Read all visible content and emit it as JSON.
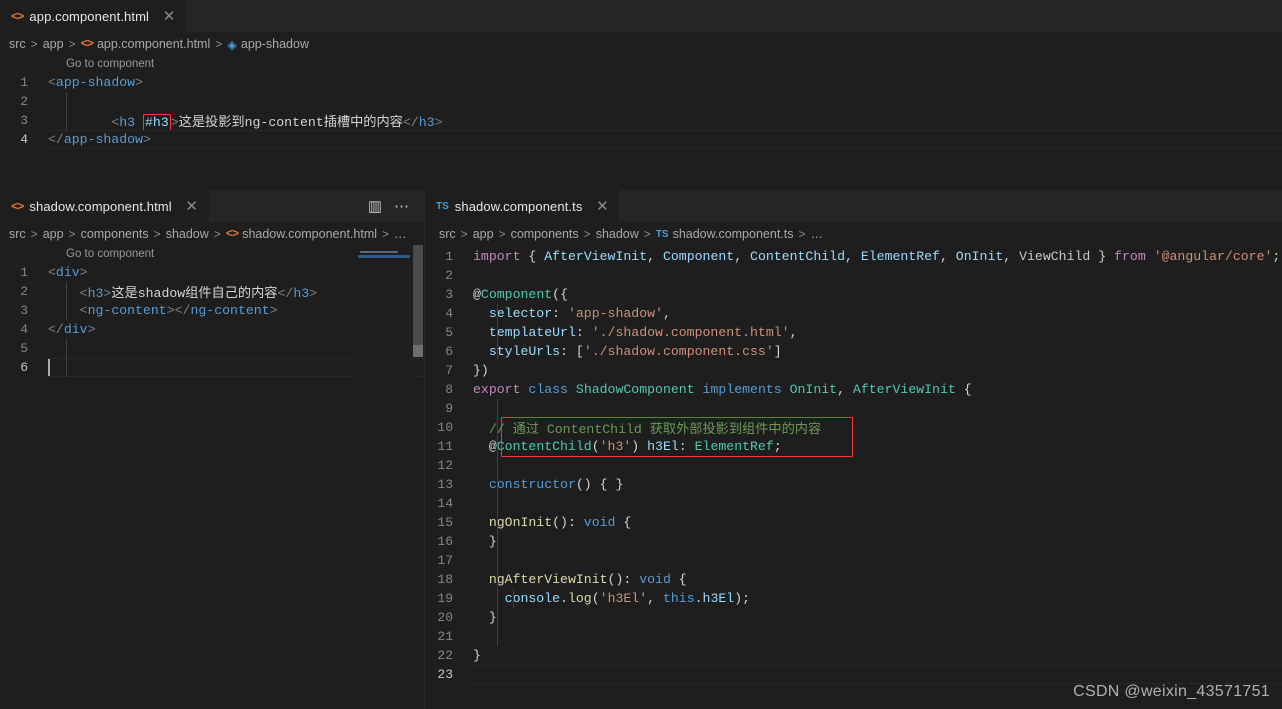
{
  "top_panel": {
    "tab": {
      "label": "app.component.html",
      "icon": "html-icon",
      "close": "✕",
      "dirty": false
    },
    "breadcrumb": [
      {
        "text": "src",
        "icon": null
      },
      {
        "text": "app",
        "icon": null
      },
      {
        "text": "app.component.html",
        "icon": "html-icon"
      },
      {
        "text": "app-shadow",
        "icon": "symbol-class-icon"
      }
    ],
    "codelens": "Go to component",
    "lines": [
      {
        "num": "1",
        "tokens": [
          {
            "t": "<",
            "c": "t-bracket"
          },
          {
            "t": "app-shadow",
            "c": "t-tag"
          },
          {
            "t": ">",
            "c": "t-bracket"
          }
        ]
      },
      {
        "num": "2",
        "tokens": []
      },
      {
        "num": "3",
        "tokens": [
          {
            "t": "        ",
            "c": "t-plain"
          },
          {
            "t": "<",
            "c": "t-bracket"
          },
          {
            "t": "h3",
            "c": "t-tag"
          },
          {
            "t": " ",
            "c": "t-plain"
          },
          {
            "t": "#h3",
            "c": "t-attr",
            "box": true
          },
          {
            "t": ">",
            "c": "t-bracket"
          },
          {
            "t": "这是投影到ng-content插槽中的内容",
            "c": "t-text"
          },
          {
            "t": "</",
            "c": "t-bracket"
          },
          {
            "t": "h3",
            "c": "t-tag"
          },
          {
            "t": ">",
            "c": "t-bracket"
          }
        ]
      },
      {
        "num": "4",
        "active": true,
        "tokens": [
          {
            "t": "</",
            "c": "t-bracket"
          },
          {
            "t": "app-shadow",
            "c": "t-tag"
          },
          {
            "t": ">",
            "c": "t-bracket"
          }
        ]
      }
    ]
  },
  "left_panel": {
    "tab": {
      "label": "shadow.component.html",
      "icon": "html-icon",
      "close": "✕"
    },
    "actions": [
      {
        "name": "split-editor-icon",
        "glyph": "▥"
      },
      {
        "name": "more-actions-icon",
        "glyph": "⋯"
      }
    ],
    "breadcrumb": [
      {
        "text": "src"
      },
      {
        "text": "app"
      },
      {
        "text": "components"
      },
      {
        "text": "shadow"
      },
      {
        "text": "shadow.component.html",
        "icon": "html-icon"
      },
      {
        "text": "…"
      }
    ],
    "codelens": "Go to component",
    "lines": [
      {
        "num": "1",
        "tokens": [
          {
            "t": "<",
            "c": "t-bracket"
          },
          {
            "t": "div",
            "c": "t-tag"
          },
          {
            "t": ">",
            "c": "t-bracket"
          }
        ]
      },
      {
        "num": "2",
        "tokens": [
          {
            "t": "    ",
            "c": "t-plain"
          },
          {
            "t": "<",
            "c": "t-bracket"
          },
          {
            "t": "h3",
            "c": "t-tag"
          },
          {
            "t": ">",
            "c": "t-bracket"
          },
          {
            "t": "这是shadow组件自己的内容",
            "c": "t-text"
          },
          {
            "t": "</",
            "c": "t-bracket"
          },
          {
            "t": "h3",
            "c": "t-tag"
          },
          {
            "t": ">",
            "c": "t-bracket"
          }
        ]
      },
      {
        "num": "3",
        "tokens": [
          {
            "t": "    ",
            "c": "t-plain"
          },
          {
            "t": "<",
            "c": "t-bracket"
          },
          {
            "t": "ng-content",
            "c": "t-tag"
          },
          {
            "t": ">",
            "c": "t-bracket"
          },
          {
            "t": "</",
            "c": "t-bracket"
          },
          {
            "t": "ng-content",
            "c": "t-tag"
          },
          {
            "t": ">",
            "c": "t-bracket"
          }
        ]
      },
      {
        "num": "4",
        "tokens": [
          {
            "t": "</",
            "c": "t-bracket"
          },
          {
            "t": "div",
            "c": "t-tag"
          },
          {
            "t": ">",
            "c": "t-bracket"
          }
        ]
      },
      {
        "num": "5",
        "tokens": []
      },
      {
        "num": "6",
        "active": true,
        "cursor": true,
        "tokens": []
      }
    ]
  },
  "right_panel": {
    "tab": {
      "label": "shadow.component.ts",
      "icon": "ts-icon",
      "close": "✕"
    },
    "breadcrumb": [
      {
        "text": "src"
      },
      {
        "text": "app"
      },
      {
        "text": "components"
      },
      {
        "text": "shadow"
      },
      {
        "text": "shadow.component.ts",
        "icon": "ts-icon"
      },
      {
        "text": "…"
      }
    ],
    "lines": [
      {
        "num": "1",
        "tokens": [
          {
            "t": "import",
            "c": "t-kw"
          },
          {
            "t": " ",
            "c": "t-plain"
          },
          {
            "t": "{",
            "c": "t-punc"
          },
          {
            "t": " ",
            "c": "t-plain"
          },
          {
            "t": "AfterViewInit",
            "c": "t-ident"
          },
          {
            "t": ", ",
            "c": "t-punc"
          },
          {
            "t": "Component",
            "c": "t-ident"
          },
          {
            "t": ", ",
            "c": "t-punc"
          },
          {
            "t": "ContentChild",
            "c": "t-ident"
          },
          {
            "t": ", ",
            "c": "t-punc"
          },
          {
            "t": "ElementRef",
            "c": "t-ident"
          },
          {
            "t": ", ",
            "c": "t-punc"
          },
          {
            "t": "OnInit",
            "c": "t-ident"
          },
          {
            "t": ", ",
            "c": "t-punc"
          },
          {
            "t": "ViewChild",
            "c": "t-dim"
          },
          {
            "t": " ",
            "c": "t-plain"
          },
          {
            "t": "}",
            "c": "t-punc"
          },
          {
            "t": " ",
            "c": "t-plain"
          },
          {
            "t": "from",
            "c": "t-kw"
          },
          {
            "t": " ",
            "c": "t-plain"
          },
          {
            "t": "'@angular/core'",
            "c": "t-string"
          },
          {
            "t": ";",
            "c": "t-punc"
          }
        ]
      },
      {
        "num": "2",
        "tokens": []
      },
      {
        "num": "3",
        "tokens": [
          {
            "t": "@",
            "c": "t-punc"
          },
          {
            "t": "Component",
            "c": "t-type"
          },
          {
            "t": "(",
            "c": "t-punc"
          },
          {
            "t": "{",
            "c": "t-punc"
          }
        ]
      },
      {
        "num": "4",
        "tokens": [
          {
            "t": "  ",
            "c": "t-plain"
          },
          {
            "t": "selector",
            "c": "t-ident"
          },
          {
            "t": ": ",
            "c": "t-punc"
          },
          {
            "t": "'app-shadow'",
            "c": "t-string"
          },
          {
            "t": ",",
            "c": "t-punc"
          }
        ]
      },
      {
        "num": "5",
        "tokens": [
          {
            "t": "  ",
            "c": "t-plain"
          },
          {
            "t": "templateUrl",
            "c": "t-ident"
          },
          {
            "t": ": ",
            "c": "t-punc"
          },
          {
            "t": "'./shadow.component.html'",
            "c": "t-string"
          },
          {
            "t": ",",
            "c": "t-punc"
          }
        ]
      },
      {
        "num": "6",
        "tokens": [
          {
            "t": "  ",
            "c": "t-plain"
          },
          {
            "t": "styleUrls",
            "c": "t-ident"
          },
          {
            "t": ": ",
            "c": "t-punc"
          },
          {
            "t": "[",
            "c": "t-punc"
          },
          {
            "t": "'./shadow.component.css'",
            "c": "t-string"
          },
          {
            "t": "]",
            "c": "t-punc"
          }
        ]
      },
      {
        "num": "7",
        "tokens": [
          {
            "t": "}",
            "c": "t-punc"
          },
          {
            "t": ")",
            "c": "t-punc"
          }
        ]
      },
      {
        "num": "8",
        "tokens": [
          {
            "t": "export",
            "c": "t-kw"
          },
          {
            "t": " ",
            "c": "t-plain"
          },
          {
            "t": "class",
            "c": "t-kw2"
          },
          {
            "t": " ",
            "c": "t-plain"
          },
          {
            "t": "ShadowComponent",
            "c": "t-type"
          },
          {
            "t": " ",
            "c": "t-plain"
          },
          {
            "t": "implements",
            "c": "t-kw2"
          },
          {
            "t": " ",
            "c": "t-plain"
          },
          {
            "t": "OnInit",
            "c": "t-type"
          },
          {
            "t": ", ",
            "c": "t-punc"
          },
          {
            "t": "AfterViewInit",
            "c": "t-type"
          },
          {
            "t": " ",
            "c": "t-plain"
          },
          {
            "t": "{",
            "c": "t-punc"
          }
        ]
      },
      {
        "num": "9",
        "tokens": []
      },
      {
        "num": "10",
        "tokens": [
          {
            "t": "  ",
            "c": "t-plain"
          },
          {
            "t": "// 通过 ContentChild 获取外部投影到组件中的内容",
            "c": "t-comment"
          }
        ]
      },
      {
        "num": "11",
        "tokens": [
          {
            "t": "  ",
            "c": "t-plain"
          },
          {
            "t": "@",
            "c": "t-punc"
          },
          {
            "t": "ContentChild",
            "c": "t-type"
          },
          {
            "t": "(",
            "c": "t-punc"
          },
          {
            "t": "'h3'",
            "c": "t-string"
          },
          {
            "t": ")",
            "c": "t-punc"
          },
          {
            "t": " ",
            "c": "t-plain"
          },
          {
            "t": "h3El",
            "c": "t-ident"
          },
          {
            "t": ": ",
            "c": "t-punc"
          },
          {
            "t": "ElementRef",
            "c": "t-type"
          },
          {
            "t": ";",
            "c": "t-punc"
          }
        ]
      },
      {
        "num": "12",
        "tokens": []
      },
      {
        "num": "13",
        "tokens": [
          {
            "t": "  ",
            "c": "t-plain"
          },
          {
            "t": "constructor",
            "c": "t-kw2"
          },
          {
            "t": "() { }",
            "c": "t-punc"
          }
        ]
      },
      {
        "num": "14",
        "tokens": []
      },
      {
        "num": "15",
        "tokens": [
          {
            "t": "  ",
            "c": "t-plain"
          },
          {
            "t": "ngOnInit",
            "c": "t-fn"
          },
          {
            "t": "(): ",
            "c": "t-punc"
          },
          {
            "t": "void",
            "c": "t-kw2"
          },
          {
            "t": " {",
            "c": "t-punc"
          }
        ]
      },
      {
        "num": "16",
        "tokens": [
          {
            "t": "  ",
            "c": "t-plain"
          },
          {
            "t": "}",
            "c": "t-punc"
          }
        ]
      },
      {
        "num": "17",
        "tokens": []
      },
      {
        "num": "18",
        "tokens": [
          {
            "t": "  ",
            "c": "t-plain"
          },
          {
            "t": "ngAfterViewInit",
            "c": "t-fn"
          },
          {
            "t": "(): ",
            "c": "t-punc"
          },
          {
            "t": "void",
            "c": "t-kw2"
          },
          {
            "t": " {",
            "c": "t-punc"
          }
        ]
      },
      {
        "num": "19",
        "tokens": [
          {
            "t": "    ",
            "c": "t-plain"
          },
          {
            "t": "console",
            "c": "t-ident"
          },
          {
            "t": ".",
            "c": "t-punc"
          },
          {
            "t": "log",
            "c": "t-fn"
          },
          {
            "t": "(",
            "c": "t-punc"
          },
          {
            "t": "'h3El'",
            "c": "t-string"
          },
          {
            "t": ", ",
            "c": "t-punc"
          },
          {
            "t": "this",
            "c": "t-kw2"
          },
          {
            "t": ".",
            "c": "t-punc"
          },
          {
            "t": "h3El",
            "c": "t-ident"
          },
          {
            "t": ");",
            "c": "t-punc"
          }
        ]
      },
      {
        "num": "20",
        "tokens": [
          {
            "t": "  ",
            "c": "t-plain"
          },
          {
            "t": "}",
            "c": "t-punc"
          }
        ]
      },
      {
        "num": "21",
        "tokens": []
      },
      {
        "num": "22",
        "tokens": [
          {
            "t": "}",
            "c": "t-punc"
          }
        ]
      },
      {
        "num": "23",
        "active": true,
        "tokens": []
      }
    ]
  },
  "watermark": "CSDN @weixin_43571751",
  "colors": {
    "editor_bg": "#1e1e1e",
    "tabbar_bg": "#252526",
    "annotation_red": "#f03a3a",
    "comment_green": "#6a9955",
    "string_orange": "#ce9178",
    "tag_blue": "#569cd6",
    "type_teal": "#4ec9b0",
    "keyword_purple": "#c586c0"
  }
}
